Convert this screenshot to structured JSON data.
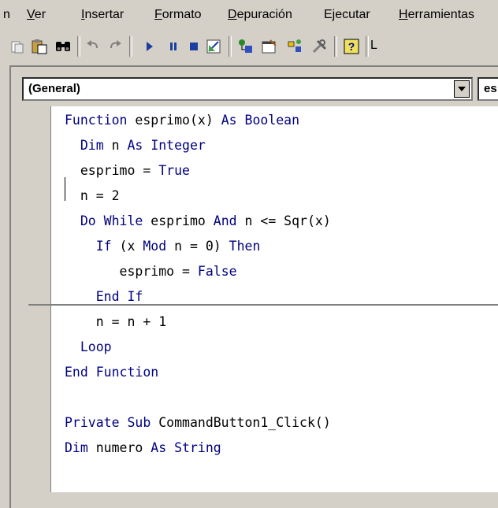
{
  "menubar": {
    "items": [
      {
        "label": "n",
        "accel": ""
      },
      {
        "label": "Ver",
        "accel": "V"
      },
      {
        "label": "Insertar",
        "accel": "I"
      },
      {
        "label": "Formato",
        "accel": "F"
      },
      {
        "label": "Depuración",
        "accel": "D"
      },
      {
        "label": "Ejecutar",
        "accel": "t"
      },
      {
        "label": "Herramientas",
        "accel": "H"
      }
    ]
  },
  "toolbar": {
    "buttons": [
      {
        "icon": "paste-icon"
      },
      {
        "icon": "paste-special-icon"
      },
      {
        "icon": "find-icon"
      },
      {
        "icon": "undo-icon"
      },
      {
        "icon": "redo-icon"
      },
      {
        "icon": "run-icon"
      },
      {
        "icon": "pause-icon"
      },
      {
        "icon": "stop-icon"
      },
      {
        "icon": "design-mode-icon"
      },
      {
        "icon": "project-explorer-icon"
      },
      {
        "icon": "properties-icon"
      },
      {
        "icon": "object-browser-icon"
      },
      {
        "icon": "toolbox-icon"
      },
      {
        "icon": "help-icon"
      }
    ],
    "overflow_text": "L"
  },
  "object_combo": {
    "value": "(General)"
  },
  "procedure_combo": {
    "value": "es"
  },
  "code": {
    "lines": [
      [
        {
          "t": "Function",
          "k": true
        },
        {
          "t": " esprimo(x) ",
          "k": false
        },
        {
          "t": "As",
          "k": true
        },
        {
          "t": " ",
          "k": false
        },
        {
          "t": "Boolean",
          "k": true
        }
      ],
      [
        {
          "t": "  ",
          "k": false
        },
        {
          "t": "Dim",
          "k": true
        },
        {
          "t": " n ",
          "k": false
        },
        {
          "t": "As",
          "k": true
        },
        {
          "t": " ",
          "k": false
        },
        {
          "t": "Integer",
          "k": true
        }
      ],
      [
        {
          "t": "  esprimo = ",
          "k": false
        },
        {
          "t": "True",
          "k": true
        }
      ],
      [
        {
          "t": "  n = 2",
          "k": false
        }
      ],
      [
        {
          "t": "  ",
          "k": false
        },
        {
          "t": "Do While",
          "k": true
        },
        {
          "t": " esprimo ",
          "k": false
        },
        {
          "t": "And",
          "k": true
        },
        {
          "t": " n <= Sqr(x)",
          "k": false
        }
      ],
      [
        {
          "t": "    ",
          "k": false
        },
        {
          "t": "If",
          "k": true
        },
        {
          "t": " (x ",
          "k": false
        },
        {
          "t": "Mod",
          "k": true
        },
        {
          "t": " n = 0) ",
          "k": false
        },
        {
          "t": "Then",
          "k": true
        }
      ],
      [
        {
          "t": "       esprimo = ",
          "k": false
        },
        {
          "t": "False",
          "k": true
        }
      ],
      [
        {
          "t": "    ",
          "k": false
        },
        {
          "t": "End If",
          "k": true
        }
      ],
      [
        {
          "t": "    n = n + 1",
          "k": false
        }
      ],
      [
        {
          "t": "  ",
          "k": false
        },
        {
          "t": "Loop",
          "k": true
        }
      ],
      [
        {
          "t": "End Function",
          "k": true
        }
      ],
      [
        {
          "t": "",
          "k": false
        }
      ],
      [
        {
          "t": "Private Sub",
          "k": true
        },
        {
          "t": " CommandButton1_Click()",
          "k": false
        }
      ],
      [
        {
          "t": "Dim",
          "k": true
        },
        {
          "t": " numero ",
          "k": false
        },
        {
          "t": "As",
          "k": true
        },
        {
          "t": " ",
          "k": false
        },
        {
          "t": "String",
          "k": true
        }
      ]
    ]
  },
  "colors": {
    "keyword": "#000080",
    "text": "#000000",
    "chrome": "#d4d0c8"
  }
}
